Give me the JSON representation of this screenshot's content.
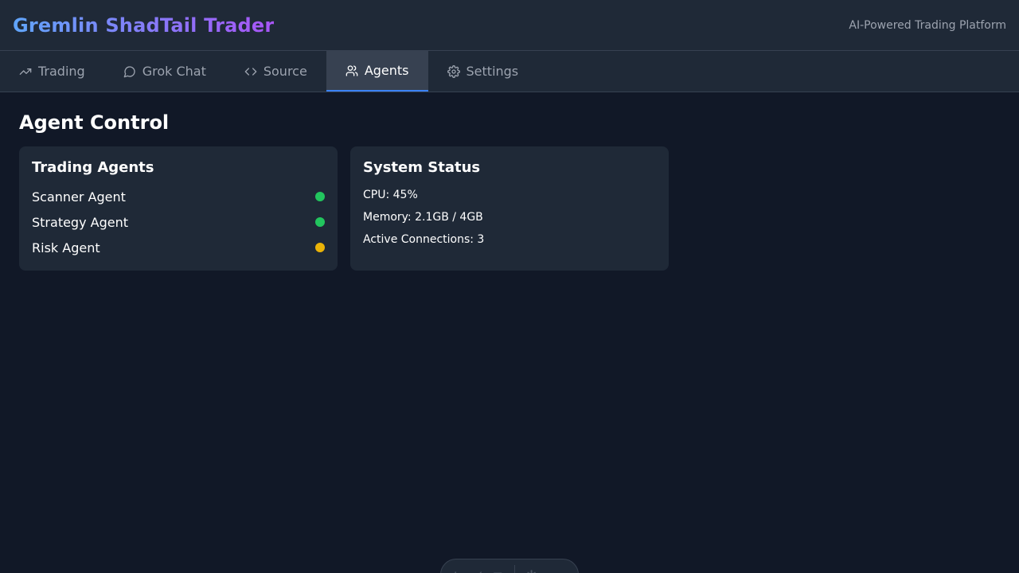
{
  "header": {
    "title": "Gremlin ShadTail Trader",
    "tagline": "AI-Powered Trading Platform"
  },
  "nav": {
    "tabs": [
      {
        "label": "Trading",
        "icon": "trending-up-icon"
      },
      {
        "label": "Grok Chat",
        "icon": "chat-bubble-icon"
      },
      {
        "label": "Source",
        "icon": "code-icon"
      },
      {
        "label": "Agents",
        "icon": "users-icon",
        "active": true
      },
      {
        "label": "Settings",
        "icon": "gear-icon"
      }
    ]
  },
  "main": {
    "title": "Agent Control",
    "agents_card": {
      "title": "Trading Agents",
      "agents": [
        {
          "name": "Scanner Agent",
          "status_color": "#22c55e"
        },
        {
          "name": "Strategy Agent",
          "status_color": "#22c55e"
        },
        {
          "name": "Risk Agent",
          "status_color": "#eab308"
        }
      ]
    },
    "status_card": {
      "title": "System Status",
      "cpu": "CPU: 45%",
      "memory": "Memory: 2.1GB / 4GB",
      "connections": "Active Connections: 3"
    }
  },
  "colors": {
    "accent": "#3b82f6",
    "brand_gradient_start": "#60a5fa",
    "brand_gradient_end": "#a855f7",
    "status_ok": "#22c55e",
    "status_warn": "#eab308"
  }
}
